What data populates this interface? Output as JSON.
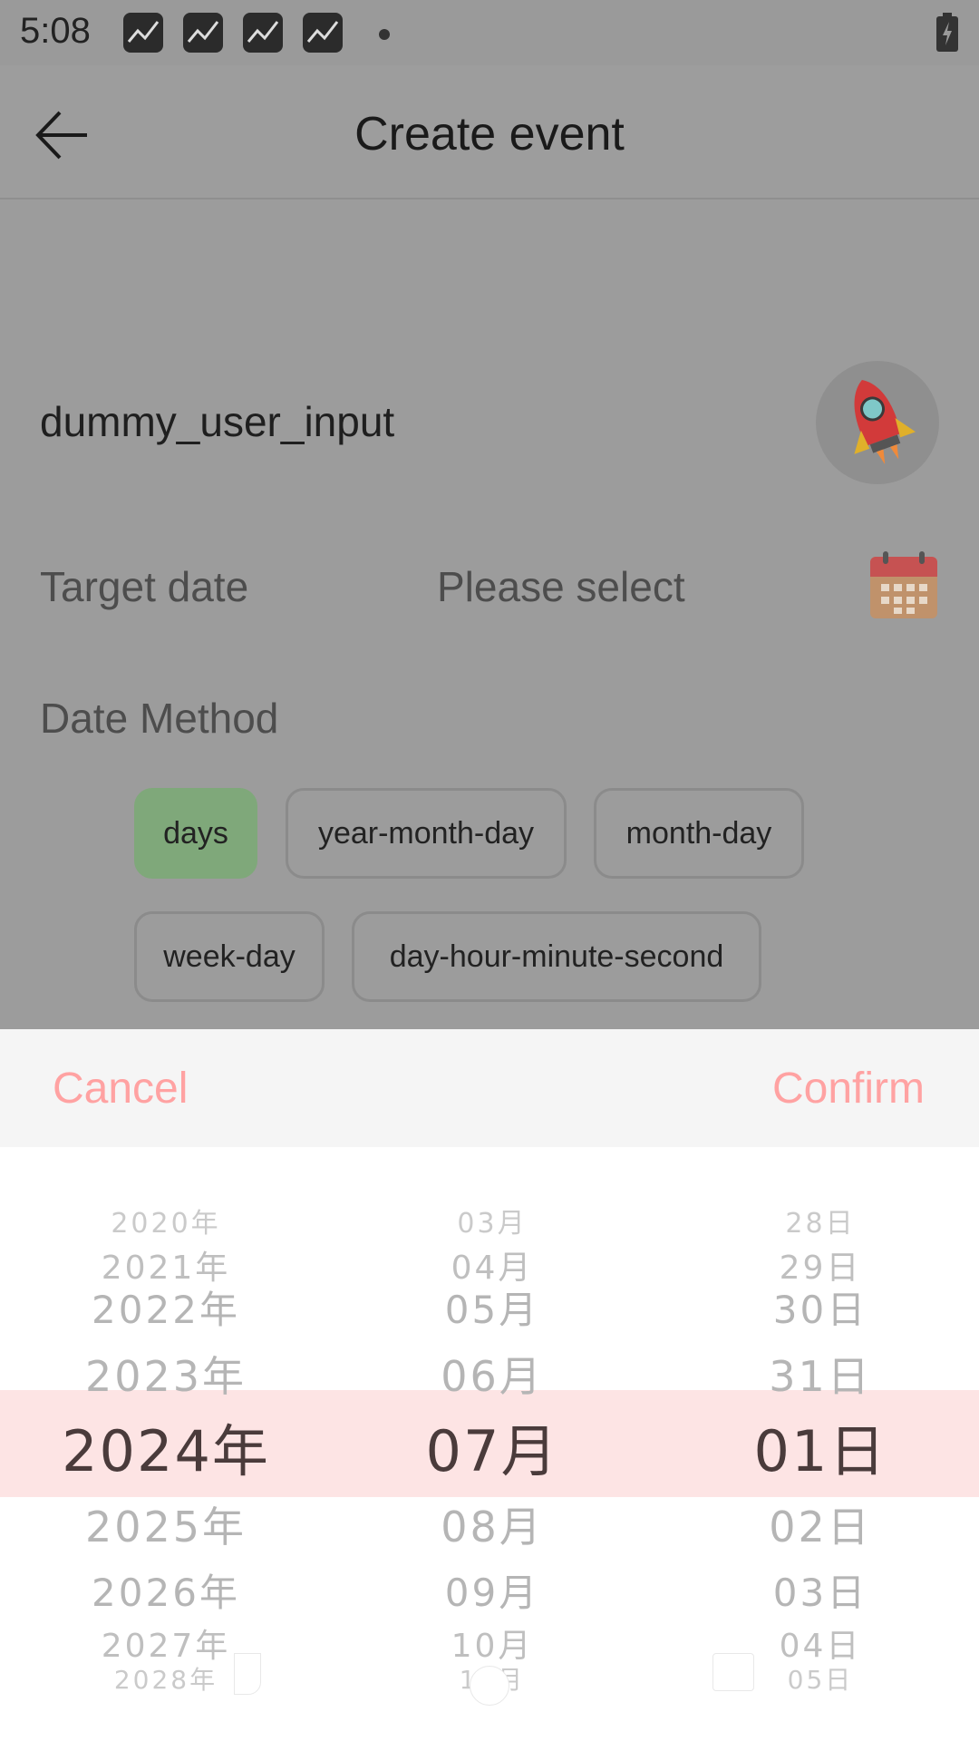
{
  "status_bar": {
    "time": "5:08",
    "app_icons": [
      "sync-app-icon",
      "sync-app-icon",
      "sync-app-icon",
      "sync-app-icon"
    ],
    "battery_icon": "battery-charging-icon"
  },
  "app_bar": {
    "title": "Create event",
    "back_icon": "arrow-left-icon"
  },
  "form": {
    "event_name": "dummy_user_input",
    "avatar_icon": "rocket-icon",
    "target_date_label": "Target date",
    "target_date_value": "Please select",
    "calendar_icon": "calendar-icon",
    "date_method_label": "Date Method",
    "date_methods": [
      {
        "label": "days",
        "selected": true
      },
      {
        "label": "year-month-day",
        "selected": false
      },
      {
        "label": "month-day",
        "selected": false
      },
      {
        "label": "week-day",
        "selected": false
      },
      {
        "label": "day-hour-minute-second",
        "selected": false
      }
    ]
  },
  "picker": {
    "cancel_label": "Cancel",
    "confirm_label": "Confirm",
    "year_items": [
      "2020年",
      "2021年",
      "2022年",
      "2023年",
      "2024年",
      "2025年",
      "2026年",
      "2027年",
      "2028年"
    ],
    "month_items": [
      "03月",
      "04月",
      "05月",
      "06月",
      "07月",
      "08月",
      "09月",
      "10月",
      "11月"
    ],
    "day_items": [
      "28日",
      "29日",
      "30日",
      "31日",
      "01日",
      "02日",
      "03日",
      "04日",
      "05日"
    ],
    "selected_year": "2024年",
    "selected_month": "07月",
    "selected_day": "01日",
    "accent_color": "#ffa2a2",
    "selection_band_color": "#fde4e4"
  }
}
